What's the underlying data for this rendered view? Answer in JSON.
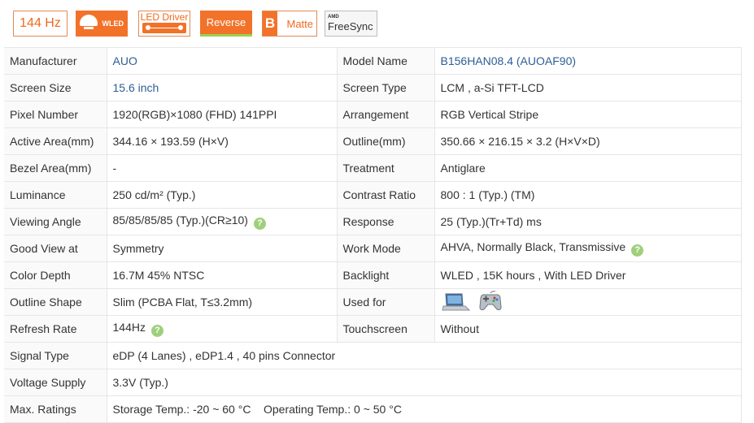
{
  "badges": {
    "refresh": "144 Hz",
    "wled": "WLED",
    "led_driver": "LED Driver",
    "reverse": "Reverse",
    "matte_letter": "B",
    "matte": "Matte",
    "amd": "AMD",
    "freesync": "FreeSync"
  },
  "rows": [
    {
      "l1": "Manufacturer",
      "v1": "AUO",
      "l2": "Model Name",
      "v2": "B156HAN08.4 (AUOAF90)"
    },
    {
      "l1": "Screen Size",
      "v1": "15.6 inch",
      "l2": "Screen Type",
      "v2": "LCM ,   a-Si TFT-LCD"
    },
    {
      "l1": "Pixel Number",
      "v1": "1920(RGB)×1080   (FHD)  141PPI",
      "l2": "Arrangement",
      "v2": "RGB Vertical Stripe"
    },
    {
      "l1": "Active Area(mm)",
      "v1": "344.16 × 193.59 (H×V)",
      "l2": "Outline(mm)",
      "v2": "350.66 × 216.15 × 3.2 (H×V×D)"
    },
    {
      "l1": "Bezel Area(mm)",
      "v1": "-",
      "l2": "Treatment",
      "v2": "Antiglare"
    },
    {
      "l1": "Luminance",
      "v1": "250 cd/m² (Typ.)",
      "l2": "Contrast Ratio",
      "v2": "800 : 1 (Typ.) (TM)"
    },
    {
      "l1": "Viewing Angle",
      "v1": "85/85/85/85 (Typ.)(CR≥10)",
      "l2": "Response",
      "v2": "25 (Typ.)(Tr+Td) ms"
    },
    {
      "l1": "Good View at",
      "v1": "Symmetry",
      "l2": "Work Mode",
      "v2": "AHVA, Normally Black, Transmissive"
    },
    {
      "l1": "Color Depth",
      "v1": "16.7M   45% NTSC",
      "l2": "Backlight",
      "v2": "WLED , 15K hours , With LED Driver"
    },
    {
      "l1": "Outline Shape",
      "v1": "Slim (PCBA Flat, T≤3.2mm)",
      "l2": "Used for",
      "v2": ""
    },
    {
      "l1": "Refresh Rate",
      "v1": "144Hz",
      "l2": "Touchscreen",
      "v2": "Without"
    },
    {
      "l1": "Signal Type",
      "v1": "eDP (4 Lanes) , eDP1.4 , 40 pins Connector"
    },
    {
      "l1": "Voltage Supply",
      "v1": "3.3V (Typ.)"
    },
    {
      "l1": "Max. Ratings",
      "v1": "Storage Temp.: -20 ~ 60 °C    Operating Temp.: 0 ~ 50 °C"
    }
  ],
  "help_mark": "?",
  "icons": [
    "laptop-icon",
    "gamepad-icon",
    "help-icon"
  ],
  "colors": {
    "accent": "#f2722a",
    "link": "#2d5e95",
    "help": "#a0cf7b"
  }
}
